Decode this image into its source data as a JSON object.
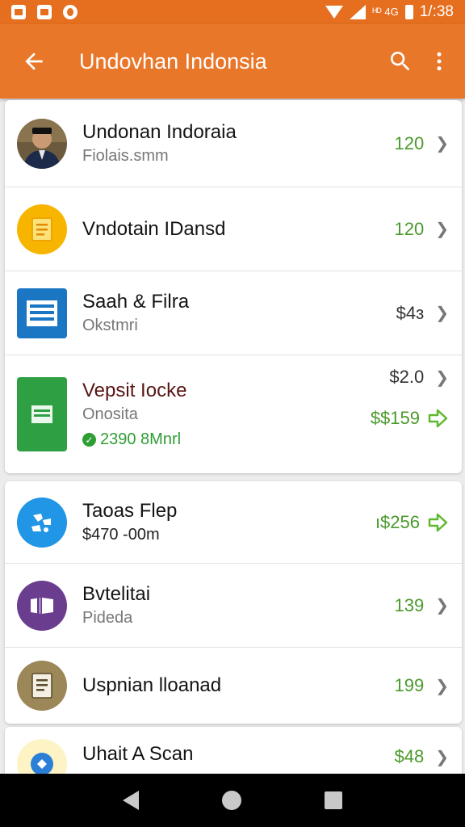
{
  "status_bar": {
    "time": "1/:38",
    "network_label": "ᴴᴰ\n4G"
  },
  "app_bar": {
    "title": "Undovhan Indonsia",
    "back_icon": "arrow-back-icon",
    "search_icon": "search-icon",
    "menu_icon": "more-vert-icon"
  },
  "colors": {
    "primary": "#e8772a",
    "accent_green": "#4a9a2c",
    "yellow": "#f7b500",
    "blue": "#1b77c4",
    "green": "#2ea043",
    "cyan": "#2196e6",
    "purple": "#6a3d8f",
    "olive": "#9b8757"
  },
  "cards": [
    {
      "items": [
        {
          "title": "Undonan Indoraia",
          "subtitle": "Fiolais.smm",
          "value": "120",
          "icon": "avatar-photo"
        },
        {
          "title": "Vndotain IDansd",
          "subtitle": "",
          "value": "120",
          "icon": "document-icon"
        },
        {
          "title": "Saah & Filra",
          "subtitle": "Okstmri",
          "value": "$4ɜ",
          "icon": "list-icon"
        },
        {
          "title": "Vepsit Iocke",
          "subtitle": "Onosita",
          "extra": "2390 8Mnrl",
          "value": "$2.0",
          "value2": "$$159",
          "icon": "sheet-icon"
        }
      ]
    },
    {
      "items": [
        {
          "title": "Taoas Flep",
          "subtitle": "$470 -00m",
          "value": "ı$256",
          "icon": "puzzle-icon"
        },
        {
          "title": "Bvtelitai",
          "subtitle": "Pideda",
          "value": "139",
          "icon": "book-icon"
        },
        {
          "title": "Uspnian lloanad",
          "subtitle": "",
          "value": "199",
          "icon": "receipt-icon"
        }
      ]
    },
    {
      "items": [
        {
          "title": "Uhait A Scan",
          "subtitle": "",
          "value": "$48",
          "icon": "scan-icon"
        }
      ]
    }
  ],
  "nav": {
    "back": "nav-back-icon",
    "home": "nav-home-icon",
    "recents": "nav-recents-icon"
  }
}
